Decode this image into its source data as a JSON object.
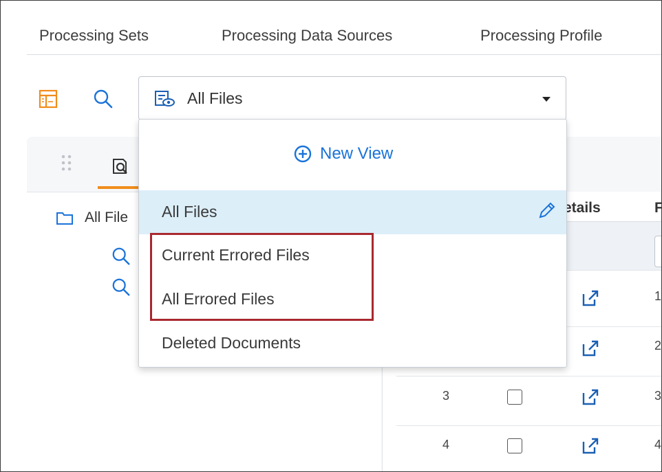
{
  "tabs": [
    "Processing Sets",
    "Processing Data Sources",
    "Processing Profile"
  ],
  "view_select": {
    "value": "All Files",
    "icon": "view-eye-icon"
  },
  "dropdown": {
    "new_view_label": "New View",
    "items": [
      {
        "label": "All Files",
        "selected": true
      },
      {
        "label": "Current Errored Files",
        "selected": false
      },
      {
        "label": "All Errored Files",
        "selected": false
      },
      {
        "label": "Deleted Documents",
        "selected": false
      }
    ]
  },
  "tree": {
    "root_label": "All File"
  },
  "grid": {
    "visible_header": "etails",
    "header_cut": "F",
    "rows": [
      {
        "num": "",
        "cut": "1"
      },
      {
        "num": "",
        "cut": "2"
      },
      {
        "num": "3",
        "cut": "3"
      },
      {
        "num": "4",
        "cut": "4"
      }
    ]
  },
  "colors": {
    "accent_orange": "#f08c1a",
    "accent_blue": "#1a73d9",
    "highlight_red": "#a8282e",
    "selected_bg": "#dceef8"
  }
}
